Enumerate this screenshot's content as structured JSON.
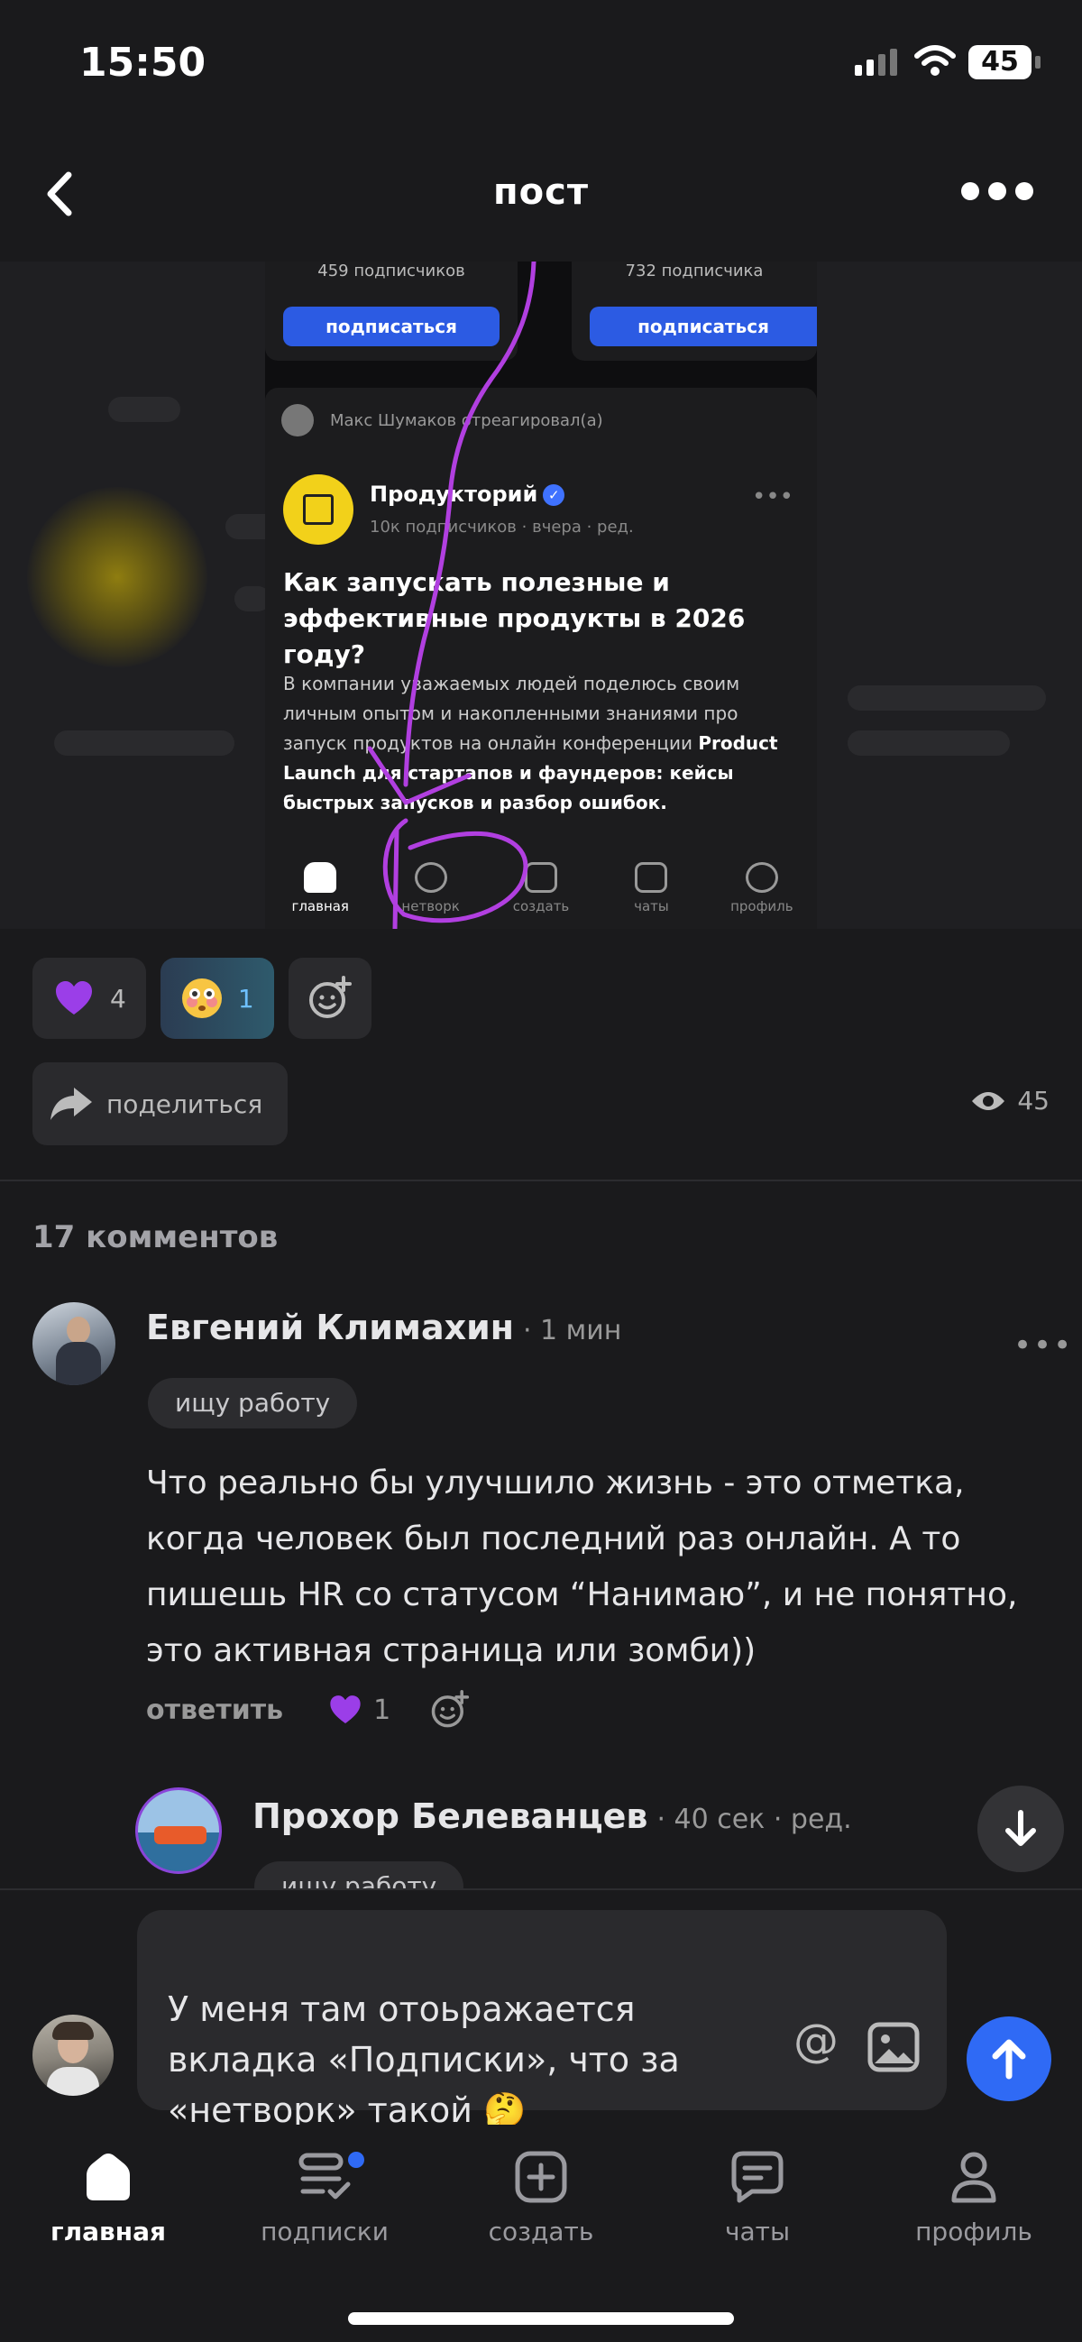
{
  "status_bar": {
    "time": "15:50",
    "battery": "45"
  },
  "header": {
    "title": "пост"
  },
  "post_image": {
    "cards": [
      {
        "subscribers": "459 подписчиков",
        "button": "подписаться"
      },
      {
        "subscribers": "732 подписчика",
        "button": "подписаться"
      }
    ],
    "reacted_line": "Макс Шумаков отреагировал(а)",
    "author": "Продукторий",
    "meta": "10к подписчиков · вчера · ред.",
    "title": "Как запускать полезные и эффективные продукты в 2026 году?",
    "text": "В компании уважаемых людей поделюсь своим личным опытом и накопленными знаниями про запуск продуктов на онлайн конференции",
    "text_bold": "Product Launch для стартапов и фаундеров: кейсы быстрых запусков и разбор ошибок.",
    "tabs": [
      "главная",
      "нетворк",
      "создать",
      "чаты",
      "профиль"
    ]
  },
  "reactions": [
    {
      "emoji": "purple-heart",
      "count": "4"
    },
    {
      "emoji": "flushed-face",
      "count": "1"
    }
  ],
  "share": {
    "label": "поделиться"
  },
  "views": {
    "count": "45"
  },
  "comments_count": "17 комментов",
  "comment": {
    "author": "Евгений Климахин",
    "time": "· 1 мин",
    "tag": "ищу работу",
    "text": "Что реально бы улучшило жизнь - это отметка, когда человек был последний раз онлайн. А то пишешь HR со статусом “Нанимаю”, и не понятно, это активная страница или зомби))",
    "reply_label": "ответить",
    "likes": "1"
  },
  "reply": {
    "author": "Прохор Белеванцев",
    "time": "· 40 сек · ред.",
    "tag": "ищу работу"
  },
  "composer": {
    "text": "У меня там отоьражается\nвкладка «Подписки», что за\n«нетворк» такой 🤔"
  },
  "tabbar": {
    "items": [
      {
        "label": "главная",
        "icon": "home-icon"
      },
      {
        "label": "подписки",
        "icon": "subscriptions-icon"
      },
      {
        "label": "создать",
        "icon": "create-icon"
      },
      {
        "label": "чаты",
        "icon": "chats-icon"
      },
      {
        "label": "профиль",
        "icon": "profile-icon"
      }
    ]
  },
  "colors": {
    "accent": "#2f6af5",
    "background": "#1a1a1c",
    "heart": "#9b3ee8",
    "scribble": "#b13fe0"
  }
}
